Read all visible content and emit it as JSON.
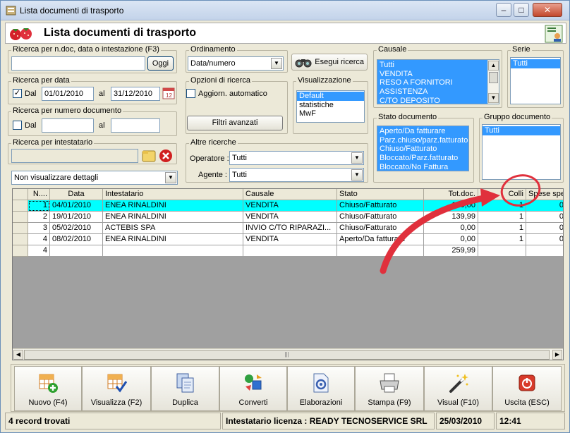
{
  "window": {
    "title": "Lista documenti di trasporto",
    "min": "‒",
    "max": "□",
    "close": "✕"
  },
  "header": {
    "title": "Lista documenti di trasporto"
  },
  "search_doc": {
    "label": "Ricerca per n.doc, data o intestazione (F3)",
    "value": "",
    "today_button": "Oggi"
  },
  "search_date": {
    "label": "Ricerca per data",
    "dal_label": "Dal",
    "dal_checked": true,
    "from": "01/01/2010",
    "al_label": "al",
    "to": "31/12/2010"
  },
  "search_number": {
    "label": "Ricerca per numero documento",
    "dal_label": "Dal",
    "dal_checked": false,
    "from": "",
    "al_label": "al",
    "to": ""
  },
  "search_holder": {
    "label": "Ricerca per intestatario",
    "value": ""
  },
  "details_select": {
    "value": "Non visualizzare dettagli"
  },
  "ordering": {
    "label": "Ordinamento",
    "value": "Data/numero"
  },
  "run_search": {
    "label": "Esegui ricerca"
  },
  "search_options": {
    "label": "Opzioni di ricerca",
    "auto_update_label": "Aggiorn. automatico",
    "auto_update_checked": false,
    "advanced_filters": "Filtri avanzati"
  },
  "view": {
    "label": "Visualizzazione",
    "items": [
      "Default",
      "statistiche",
      "MwF"
    ],
    "selected": 0
  },
  "other_search": {
    "label": "Altre ricerche",
    "operator_label": "Operatore :",
    "operator_value": "Tutti",
    "agent_label": "Agente :",
    "agent_value": "Tutti"
  },
  "causale": {
    "label": "Causale",
    "items": [
      "Tutti",
      "VENDITA",
      "RESO A FORNITORI",
      "ASSISTENZA",
      "C/TO DEPOSITO"
    ]
  },
  "serie": {
    "label": "Serie",
    "items": [
      "Tutti"
    ]
  },
  "stato_doc": {
    "label": "Stato documento",
    "items": [
      "Aperto/Da fatturare",
      "Parz.chiuso/parz.fatturato",
      "Chiuso/Fatturato",
      "Bloccato/Parz.fatturato",
      "Bloccato/No Fattura"
    ]
  },
  "gruppo_doc": {
    "label": "Gruppo documento",
    "items": [
      "Tutti"
    ]
  },
  "table": {
    "columns": [
      "N....",
      "Data",
      "Intestatario",
      "Causale",
      "Stato",
      "Tot.doc.",
      "Colli",
      "Spese spe"
    ],
    "rows": [
      [
        "1",
        "04/01/2010",
        "ENEA RINALDINI",
        "VENDITA",
        "Chiuso/Fatturato",
        "120,00",
        "1",
        "0,"
      ],
      [
        "2",
        "19/01/2010",
        "ENEA RINALDINI",
        "VENDITA",
        "Chiuso/Fatturato",
        "139,99",
        "1",
        "0,"
      ],
      [
        "3",
        "05/02/2010",
        "ACTEBIS SPA",
        "INVIO C/TO RIPARAZI...",
        "Chiuso/Fatturato",
        "0,00",
        "1",
        "0,"
      ],
      [
        "4",
        "08/02/2010",
        "ENEA RINALDINI",
        "VENDITA",
        "Aperto/Da fatturare",
        "0,00",
        "1",
        "0,"
      ],
      [
        "4",
        "",
        "",
        "",
        "",
        "259,99",
        "",
        ""
      ]
    ],
    "selected_row": 0,
    "highlight_color": "#00ffff",
    "hscroll_grip": "|||"
  },
  "toolbar": {
    "buttons": [
      {
        "label": "Nuovo (F4)",
        "icon": "new-grid-icon"
      },
      {
        "label": "Visualizza (F2)",
        "icon": "view-grid-icon"
      },
      {
        "label": "Duplica",
        "icon": "duplicate-icon"
      },
      {
        "label": "Converti",
        "icon": "convert-icon"
      },
      {
        "label": "Elaborazioni",
        "icon": "process-icon"
      },
      {
        "label": "Stampa (F9)",
        "icon": "printer-icon"
      },
      {
        "label": "Visual (F10)",
        "icon": "magic-wand-icon"
      },
      {
        "label": "Uscita (ESC)",
        "icon": "power-icon"
      }
    ]
  },
  "status": {
    "records": "4 record trovati",
    "license": "Intestatario licenza : READY TECNOSERVICE SRL",
    "date": "25/03/2010",
    "time": "12:41"
  },
  "colors": {
    "selection": "#3399ff",
    "annotation": "#e0303c"
  }
}
